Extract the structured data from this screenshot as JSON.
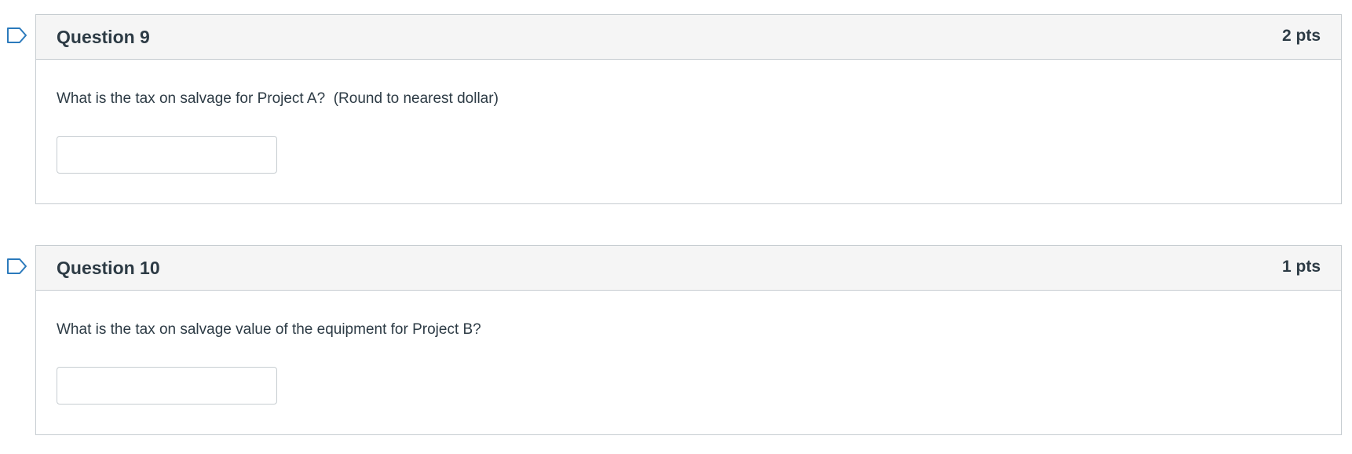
{
  "questions": [
    {
      "title": "Question 9",
      "points": "2 pts",
      "text": "What is the tax on salvage for Project A?  (Round to nearest dollar)",
      "answer_value": "",
      "flag_icon": "bookmark-flag-icon"
    },
    {
      "title": "Question 10",
      "points": "1 pts",
      "text": "What is the tax on salvage value of the equipment for Project B?",
      "answer_value": "",
      "flag_icon": "bookmark-flag-icon"
    }
  ],
  "colors": {
    "flag_stroke": "#2b7abc",
    "header_bg": "#f5f5f5",
    "border": "#c7cdd1",
    "text": "#2d3b45"
  }
}
